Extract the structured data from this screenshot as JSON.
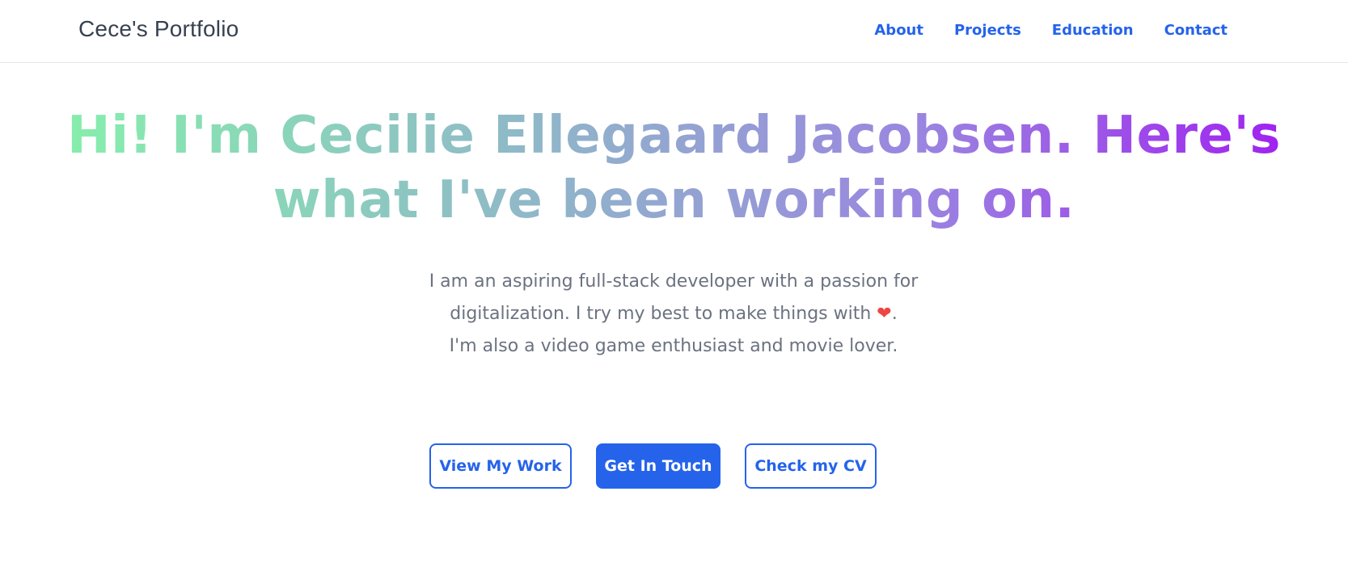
{
  "navbar": {
    "brand": "Cece's Portfolio",
    "links": [
      "About",
      "Projects",
      "Education",
      "Contact"
    ]
  },
  "hero": {
    "title_line1": "Hi! I'm Cecilie Ellegaard Jacobsen. Here's",
    "title_line2": "what I've been working on.",
    "sub_line1": "I am an aspiring full-stack developer with a passion for",
    "sub_line2_before": "digitalization. I try my best to make things with",
    "heart": "❤",
    "sub_line2_after": ".",
    "sub_line3": "I'm also a video game enthusiast and movie lover."
  },
  "buttons": {
    "view_work": "View My Work",
    "get_in_touch": "Get In Touch",
    "check_cv": "Check my CV"
  },
  "colors": {
    "accent": "#2563eb",
    "gradient_start": "#86efac",
    "gradient_end": "#a020f0",
    "text_muted": "#6b7280"
  }
}
